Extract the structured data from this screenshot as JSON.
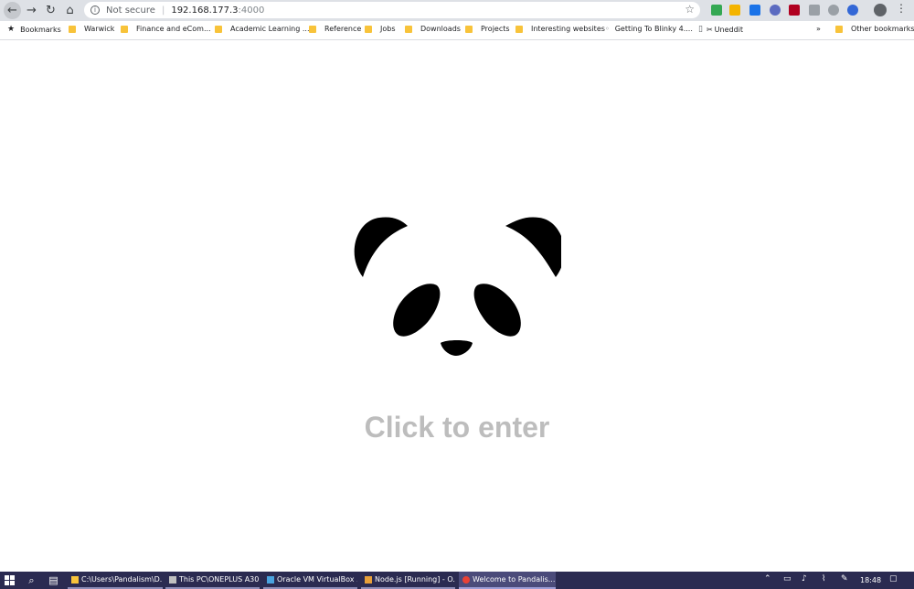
{
  "browser": {
    "url_security_label": "Not secure",
    "url_host": "192.168.177.3",
    "url_port": ":4000",
    "bookmarks": [
      {
        "label": "Bookmarks",
        "icon": "star-icon"
      },
      {
        "label": "Warwick",
        "icon": "folder-icon"
      },
      {
        "label": "Finance and eCom...",
        "icon": "folder-icon"
      },
      {
        "label": "Academic Learning ...",
        "icon": "folder-icon"
      },
      {
        "label": "Reference",
        "icon": "folder-icon"
      },
      {
        "label": "Jobs",
        "icon": "folder-icon"
      },
      {
        "label": "Downloads",
        "icon": "folder-icon"
      },
      {
        "label": "Projects",
        "icon": "folder-icon"
      },
      {
        "label": "Interesting websites",
        "icon": "folder-icon"
      },
      {
        "label": "Getting To Blinky 4....",
        "icon": "page-icon"
      },
      {
        "label": "Uneddit",
        "icon": "scissors-icon"
      }
    ],
    "overflow_label": "»",
    "other_bookmarks": "Other bookmarks"
  },
  "page": {
    "cta_text": "Click to enter"
  },
  "taskbar": {
    "tasks": [
      {
        "label": "C:\\Users\\Pandalism\\D...",
        "icon": "folder-icon"
      },
      {
        "label": "This PC\\ONEPLUS A30...",
        "icon": "phone-icon"
      },
      {
        "label": "Oracle VM VirtualBox ...",
        "icon": "virtualbox-icon"
      },
      {
        "label": "Node.js [Running] - O...",
        "icon": "node-icon"
      },
      {
        "label": "Welcome to Pandalis...",
        "icon": "chrome-icon"
      }
    ],
    "clock": "18:48"
  },
  "colors": {
    "taskbar_bg": "#2b2b51",
    "cta_text": "#bdbdbd",
    "folder": "#f8c33a"
  }
}
